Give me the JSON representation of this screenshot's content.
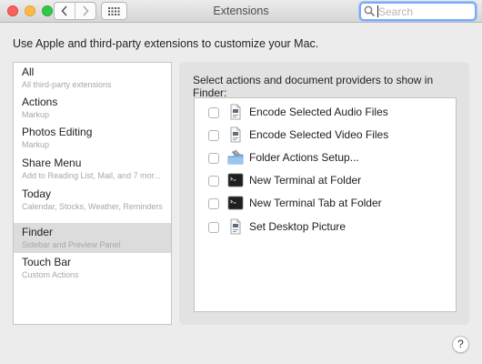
{
  "window": {
    "title": "Extensions"
  },
  "search": {
    "placeholder": "Search",
    "value": ""
  },
  "intro": "Use Apple and third-party extensions to customize your Mac.",
  "categories": [
    {
      "name": "All",
      "subtitle": "All third-party extensions",
      "selected": false
    },
    {
      "name": "Actions",
      "subtitle": "Markup",
      "selected": false
    },
    {
      "name": "Photos Editing",
      "subtitle": "Markup",
      "selected": false
    },
    {
      "name": "Share Menu",
      "subtitle": "Add to Reading List, Mail, and 7 mor...",
      "selected": false
    },
    {
      "name": "Today",
      "subtitle": "Calendar, Stocks, Weather, Reminders",
      "selected": false
    },
    {
      "name": "Finder",
      "subtitle": "Sidebar and Preview Panel",
      "selected": true
    },
    {
      "name": "Touch Bar",
      "subtitle": "Custom Actions",
      "selected": false
    }
  ],
  "panel": {
    "heading": "Select actions and document providers to show in Finder:",
    "items": [
      {
        "label": "Encode Selected Audio Files",
        "checked": false,
        "icon": "workflow-document-icon"
      },
      {
        "label": "Encode Selected Video Files",
        "checked": false,
        "icon": "workflow-document-icon"
      },
      {
        "label": "Folder Actions Setup...",
        "checked": false,
        "icon": "folder-actions-icon"
      },
      {
        "label": "New Terminal at Folder",
        "checked": false,
        "icon": "terminal-icon"
      },
      {
        "label": "New Terminal Tab at Folder",
        "checked": false,
        "icon": "terminal-icon"
      },
      {
        "label": "Set Desktop Picture",
        "checked": false,
        "icon": "workflow-document-icon"
      }
    ]
  },
  "help": {
    "label": "?"
  },
  "colors": {
    "window_bg": "#ececec",
    "selected_row": "#dcdcdc",
    "focus_ring": "#7daaf2",
    "close": "#fc605b",
    "minimize": "#fdbc40",
    "maximize": "#34c84a"
  }
}
